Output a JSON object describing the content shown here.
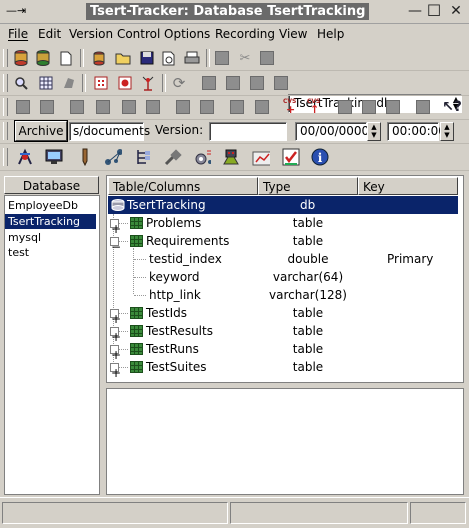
{
  "window": {
    "title": "Tsert-Tracker: Database TsertTracking",
    "controls": {
      "minimize": "—",
      "maximize": "☐",
      "close": "✕"
    }
  },
  "menu": [
    "File",
    "Edit",
    "Version Control",
    "Options",
    "Recording",
    "View",
    "Help"
  ],
  "toolbar1": {
    "db_select_value": "TsertTracking.db"
  },
  "toolbar3": {
    "cvs_label_1": "CVS",
    "cvs_label_2": "CVS"
  },
  "version_bar": {
    "archive_button": "Archive",
    "path_value": "s/documents",
    "version_label": "Version:",
    "version_value": "",
    "date_value": "00/00/0000",
    "time_value": "00:00:00"
  },
  "database_panel": {
    "header": "Database",
    "items": [
      "EmployeeDb",
      "TsertTracking",
      "mysql",
      "test"
    ],
    "selected": "TsertTracking"
  },
  "tree_panel": {
    "columns": [
      "Table/Columns",
      "Type",
      "Key"
    ],
    "root": {
      "name": "TsertTracking",
      "type": "db"
    },
    "rows": [
      {
        "name": "Problems",
        "type": "table",
        "key": "",
        "level": 1,
        "expander": "+"
      },
      {
        "name": "Requirements",
        "type": "table",
        "key": "",
        "level": 1,
        "expander": "−"
      },
      {
        "name": "testid_index",
        "type": "double",
        "key": "Primary",
        "level": 2,
        "expander": ""
      },
      {
        "name": "keyword",
        "type": "varchar(64)",
        "key": "",
        "level": 2,
        "expander": ""
      },
      {
        "name": "http_link",
        "type": "varchar(128)",
        "key": "",
        "level": 2,
        "expander": ""
      },
      {
        "name": "TestIds",
        "type": "table",
        "key": "",
        "level": 1,
        "expander": "+"
      },
      {
        "name": "TestResults",
        "type": "table",
        "key": "",
        "level": 1,
        "expander": "+"
      },
      {
        "name": "TestRuns",
        "type": "table",
        "key": "",
        "level": 1,
        "expander": "+"
      },
      {
        "name": "TestSuites",
        "type": "table",
        "key": "",
        "level": 1,
        "expander": "+"
      }
    ]
  },
  "colors": {
    "selection": "#0a246a",
    "window_bg": "#d4d0c8",
    "table_icon": "#3a8a3a"
  }
}
